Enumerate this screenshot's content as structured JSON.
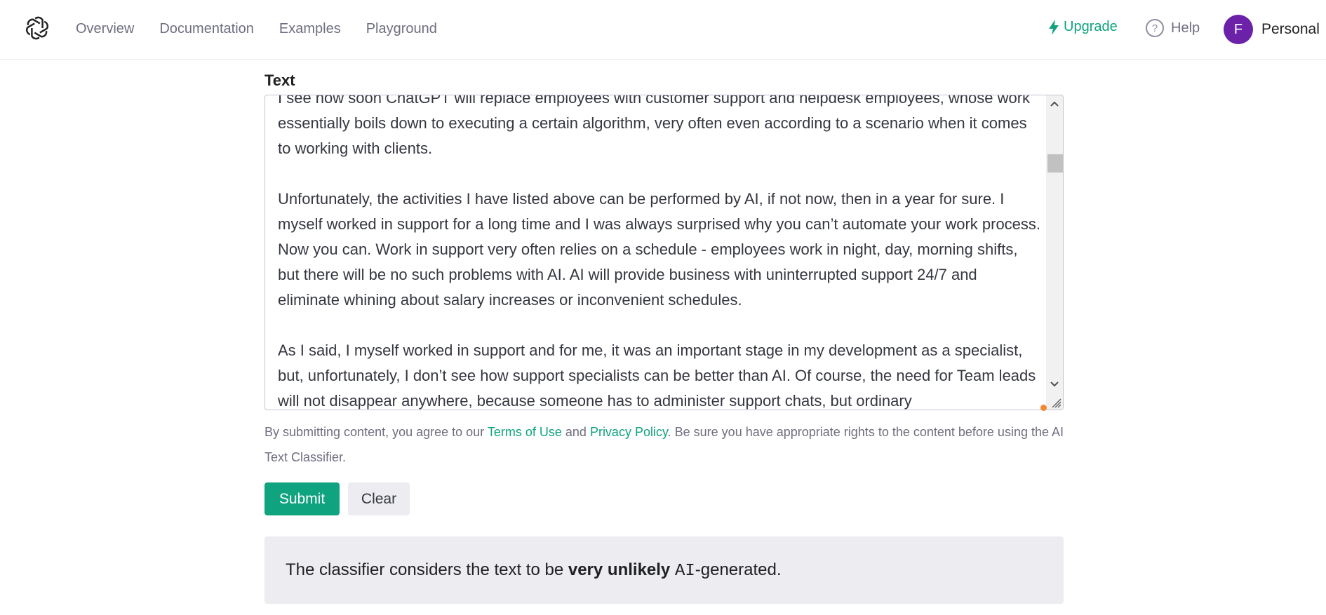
{
  "header": {
    "nav": [
      "Overview",
      "Documentation",
      "Examples",
      "Playground"
    ],
    "upgrade_label": "Upgrade",
    "help_label": "Help",
    "account": {
      "initial": "F",
      "name": "Personal"
    }
  },
  "main": {
    "section_label": "Text",
    "textarea_value": "I see how soon ChatGPT will replace employees with customer support and helpdesk employees, whose work essentially boils down to executing a certain algorithm, very often even according to a scenario when it comes to working with clients.\n\nUnfortunately, the activities I have listed above can be performed by AI, if not now, then in a year for sure. I myself worked in support for a long time and I was always surprised why you can’t automate your work process. Now you can. Work in support very often relies on a schedule - employees work in night, day, morning shifts, but there will be no such problems with AI. AI will provide business with uninterrupted support 24/7 and eliminate whining about salary increases or inconvenient schedules.\n\nAs I said, I myself worked in support and for me, it was an important stage in my development as a specialist, but, unfortunately, I don’t see how support specialists can be better than AI. Of course, the need for Team leads will not disappear anywhere, because someone has to administer support chats, but ordinary",
    "disclaimer": {
      "prefix": "By submitting content, you agree to our ",
      "terms": "Terms of Use",
      "and": " and ",
      "privacy": "Privacy Policy",
      "suffix": ". Be sure you have appropriate rights to the content before using the ",
      "ai_name": "AI Text Classifier",
      "end": "."
    },
    "submit_label": "Submit",
    "clear_label": "Clear",
    "result": {
      "prefix": "The classifier considers the text to be ",
      "verdict": "very unlikely",
      "ai": "AI",
      "suffix": "-generated."
    }
  },
  "colors": {
    "accent": "#10a37f",
    "avatar": "#6b21a8",
    "result_bg": "#ececf1"
  }
}
